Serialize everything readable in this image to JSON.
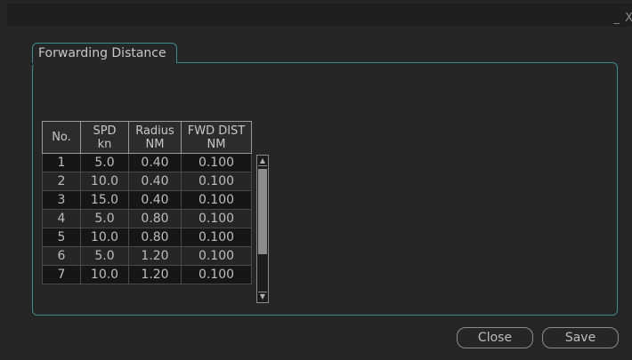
{
  "window": {
    "controls": "_ X"
  },
  "tab": {
    "label": "Forwarding Distance"
  },
  "table": {
    "headers": [
      {
        "line1": "No.",
        "line2": ""
      },
      {
        "line1": "SPD",
        "line2": "kn"
      },
      {
        "line1": "Radius",
        "line2": "NM"
      },
      {
        "line1": "FWD DIST",
        "line2": "NM"
      }
    ],
    "rows": [
      [
        "1",
        "5.0",
        "0.40",
        "0.100"
      ],
      [
        "2",
        "10.0",
        "0.40",
        "0.100"
      ],
      [
        "3",
        "15.0",
        "0.40",
        "0.100"
      ],
      [
        "4",
        "5.0",
        "0.80",
        "0.100"
      ],
      [
        "5",
        "10.0",
        "0.80",
        "0.100"
      ],
      [
        "6",
        "5.0",
        "1.20",
        "0.100"
      ],
      [
        "7",
        "10.0",
        "1.20",
        "0.100"
      ]
    ]
  },
  "buttons": {
    "close": "Close",
    "save": "Save"
  },
  "colors": {
    "accent": "#3d8a92",
    "background": "#262626"
  }
}
